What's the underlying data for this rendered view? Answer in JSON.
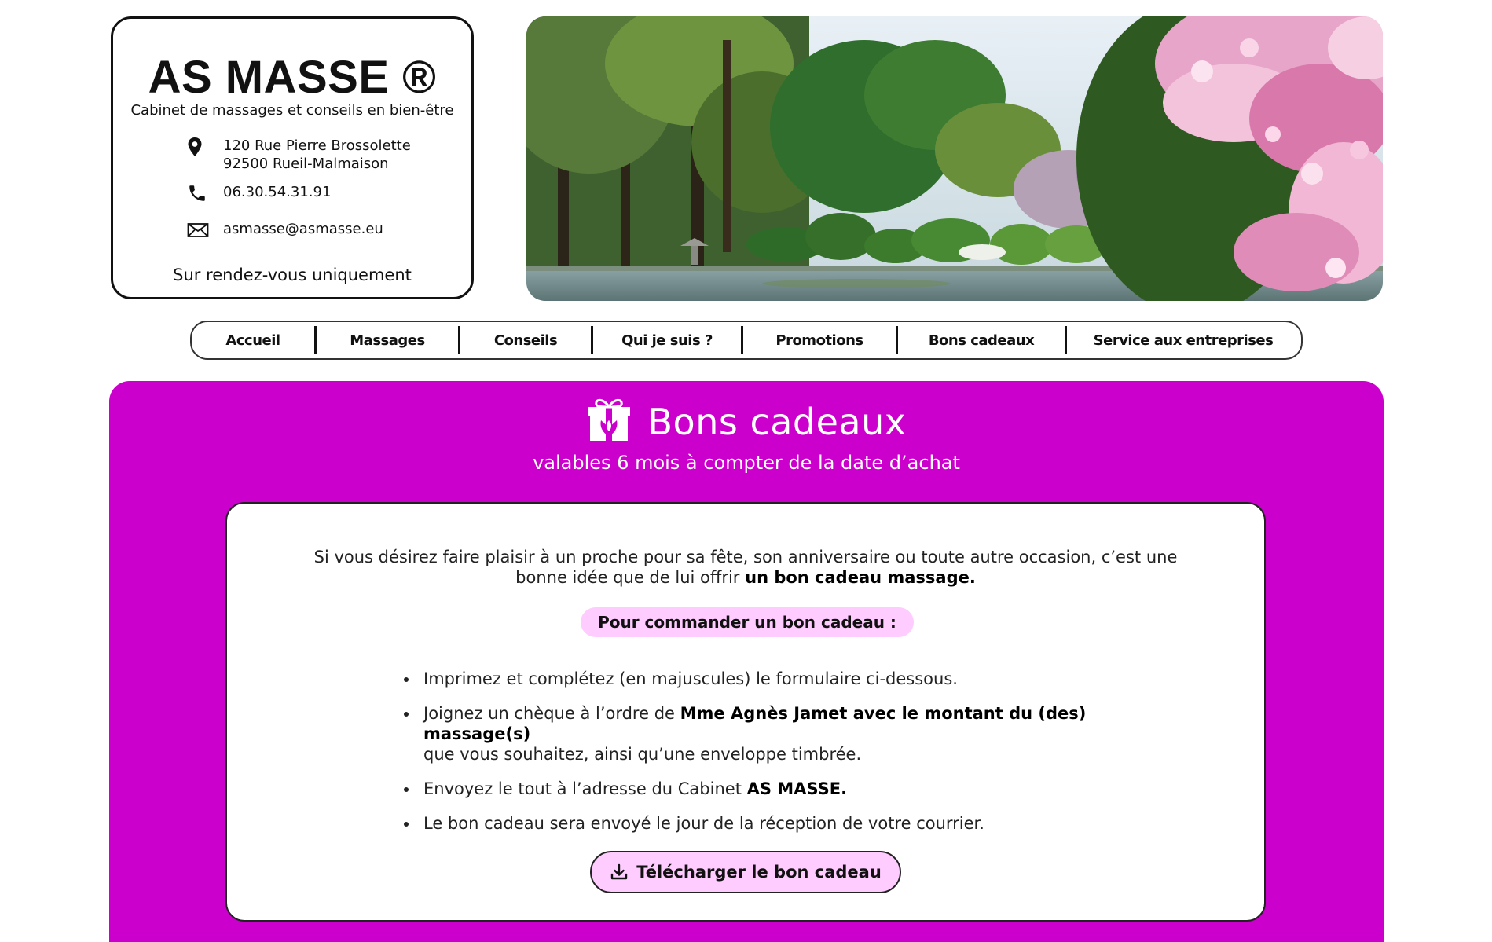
{
  "header": {
    "brand": "AS MASSE ®",
    "tagline": "Cabinet de massages et conseils en bien-être",
    "address_line1": "120 Rue Pierre Brossolette",
    "address_line2": "92500 Rueil-Malmaison",
    "phone": "06.30.54.31.91",
    "email": "asmasse@asmasse.eu",
    "appointment_note": "Sur rendez-vous uniquement",
    "icons": [
      "location-pin-icon",
      "phone-icon",
      "envelope-icon"
    ]
  },
  "nav": {
    "items": [
      {
        "label": "Accueil"
      },
      {
        "label": "Massages"
      },
      {
        "label": "Conseils"
      },
      {
        "label": "Qui je suis ?"
      },
      {
        "label": "Promotions"
      },
      {
        "label": "Bons cadeaux"
      },
      {
        "label": "Service aux entreprises"
      }
    ]
  },
  "main": {
    "title": "Bons cadeaux",
    "subtitle": "valables 6 mois à compter de la date d’achat",
    "intro_text": "Si vous désirez faire plaisir à un proche pour sa fête, son anniversaire ou toute autre occasion, c’est une bonne idée que de lui offrir ",
    "intro_bold": "un bon cadeau massage.",
    "order_heading": "Pour commander un bon cadeau :",
    "steps": [
      {
        "text": "Imprimez et complétez (en majuscules) le formulaire ci-dessous.",
        "bold": "",
        "after": ""
      },
      {
        "text": "Joignez un chèque à l’ordre de ",
        "bold": "Mme Agnès Jamet avec le montant du (des) massage(s)",
        "after": " que vous souhaitez, ainsi qu’une enveloppe timbrée."
      },
      {
        "text": "Envoyez le tout à l’adresse du Cabinet ",
        "bold": "AS MASSE.",
        "after": ""
      },
      {
        "text": "Le bon cadeau sera envoyé le jour de la réception de votre courrier.",
        "bold": "",
        "after": ""
      }
    ],
    "download_label": "Télécharger le bon cadeau"
  },
  "colors": {
    "accent": "#cc00cc",
    "pill": "#ffccff"
  }
}
